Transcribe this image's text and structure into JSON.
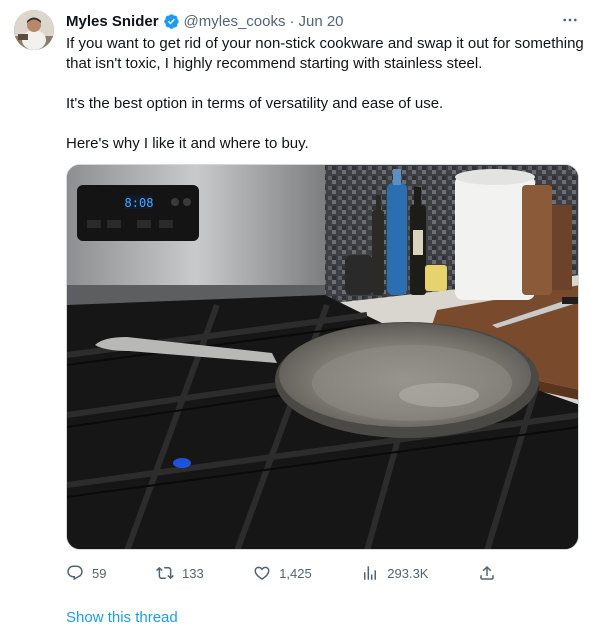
{
  "tweet": {
    "author_name": "Myles Snider",
    "handle": "@myles_cooks",
    "separator": "·",
    "date": "Jun 20",
    "paragraphs": [
      "If you want to get rid of your non-stick cookware and swap it out for something that isn't toxic, I highly recommend starting with stainless steel.",
      "It's the best option in terms of versatility and ease of use.",
      "Here's why I like it and where to buy."
    ],
    "more_icon": "more-horizontal-icon",
    "verified_icon": "verified-badge-icon",
    "media": {
      "oven_clock": "8:08"
    },
    "actions": {
      "replies": "59",
      "retweets": "133",
      "likes": "1,425",
      "views": "293.3K"
    },
    "show_thread": "Show this thread"
  },
  "colors": {
    "link": "#1d9bf0",
    "secondary_text": "#536471",
    "primary_text": "#0f1419"
  }
}
